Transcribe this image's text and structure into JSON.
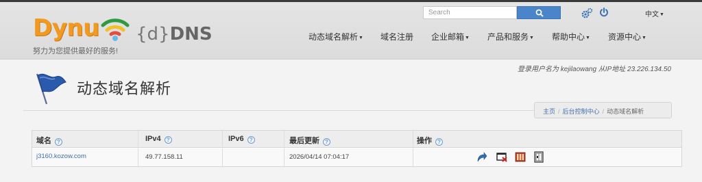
{
  "header": {
    "logo_text": "Dynu",
    "dns_brace_text": "{d}",
    "dns_bold_text": "DNS",
    "tagline": "努力为您提供最好的服务!",
    "search_placeholder": "Search",
    "language": "中文",
    "nav": [
      {
        "label": "动态域名解析",
        "has_caret": true
      },
      {
        "label": "域名注册",
        "has_caret": false
      },
      {
        "label": "企业邮箱",
        "has_caret": true
      },
      {
        "label": "产品和服务",
        "has_caret": true
      },
      {
        "label": "帮助中心",
        "has_caret": true
      },
      {
        "label": "资源中心",
        "has_caret": true
      }
    ]
  },
  "login_info": "登录用户名为 kejilaowang 从IP地址 23.226.134.50",
  "page": {
    "title": "动态域名解析"
  },
  "breadcrumb": {
    "home": "主页",
    "control_panel": "后台控制中心",
    "current": "动态域名解析"
  },
  "table": {
    "headers": [
      "域名",
      "IPv4",
      "IPv6",
      "最后更新",
      "操作"
    ],
    "help_glyph": "?",
    "rows": [
      {
        "domain": "j3160.kozow.com",
        "ipv4": "49.77.158.11",
        "ipv6": "",
        "last_updated": "2026/04/14 07:04:17"
      }
    ]
  },
  "colors": {
    "brand_orange": "#f29a1f",
    "link_blue": "#3f6fae",
    "search_button": "#4a85c9"
  },
  "icons": [
    "search-icon",
    "gear-icon",
    "power-icon",
    "flag-icon",
    "help-icon",
    "redirect-icon",
    "web-redirect-icon",
    "columns-icon",
    "door-icon"
  ]
}
